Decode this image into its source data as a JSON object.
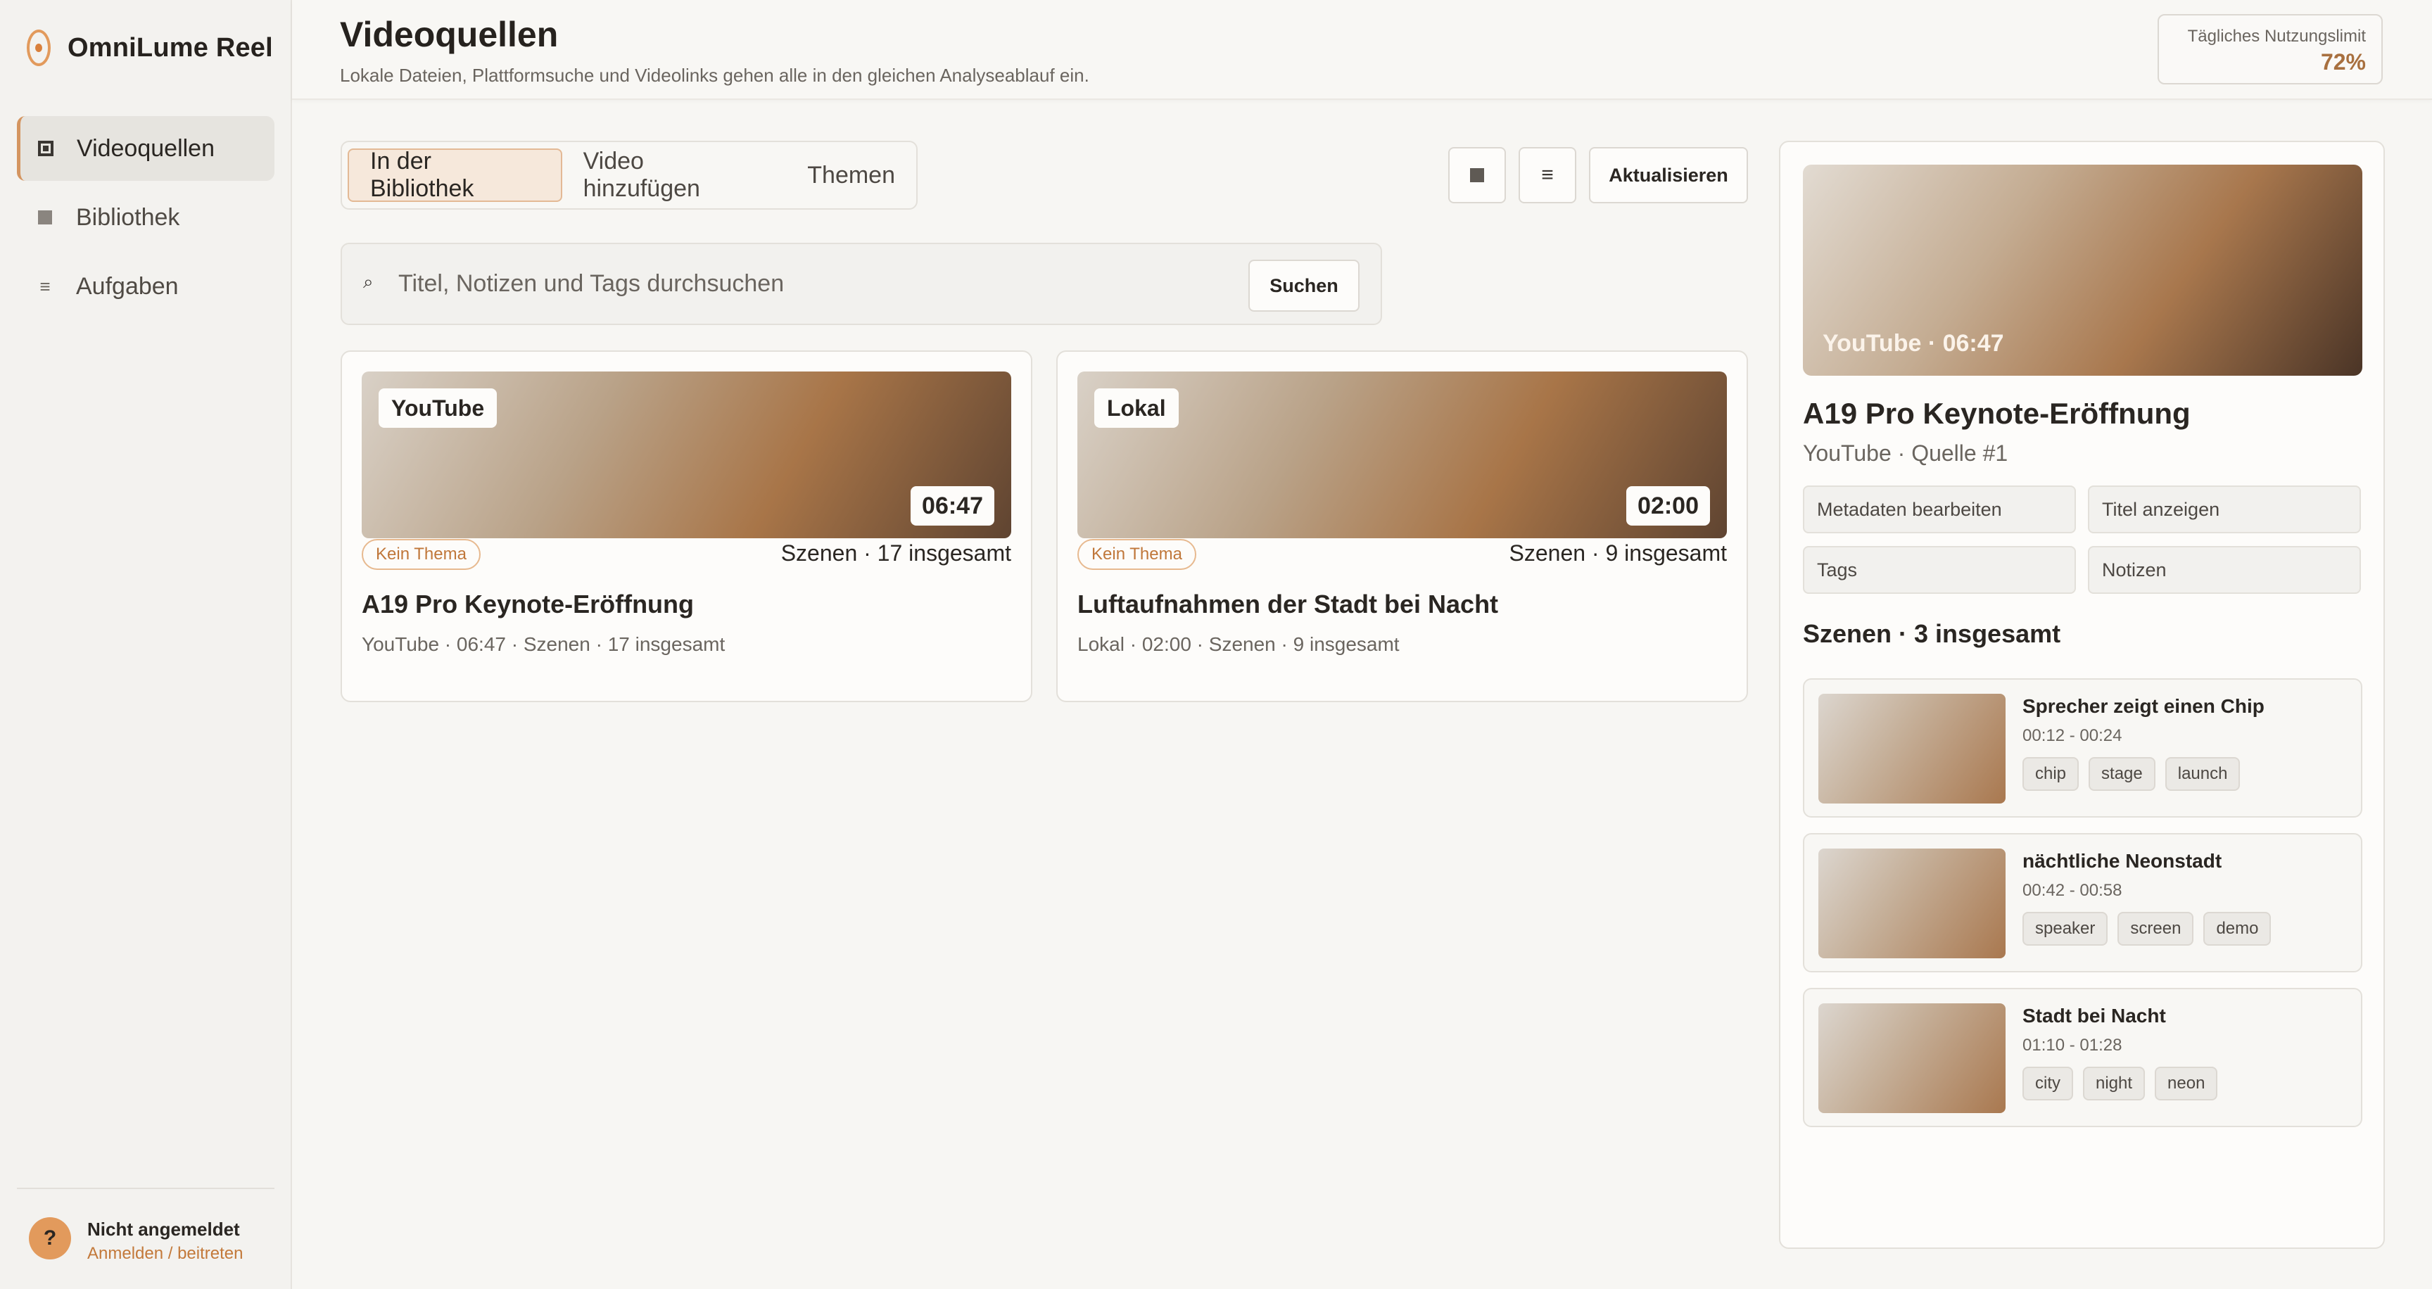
{
  "app": {
    "name": "OmniLume Reel"
  },
  "sidebar": {
    "items": [
      {
        "label": "Videoquellen",
        "icon": "video-sources-icon"
      },
      {
        "label": "Bibliothek",
        "icon": "library-icon"
      },
      {
        "label": "Aufgaben",
        "icon": "tasks-icon"
      }
    ],
    "user": {
      "avatar": "?",
      "name": "Nicht angemeldet",
      "link": "Anmelden / beitreten"
    }
  },
  "header": {
    "title": "Videoquellen",
    "subtitle": "Lokale Dateien, Plattformsuche und Videolinks gehen alle in den gleichen Analyseablauf ein.",
    "usage_label": "Tägliches Nutzungslimit",
    "usage_value": "72%",
    "usage_fraction": 0.72
  },
  "tabs": [
    {
      "label": "In der Bibliothek",
      "active": true
    },
    {
      "label": "Video hinzufügen",
      "active": false
    },
    {
      "label": "Themen",
      "active": false
    }
  ],
  "toolbar": {
    "grid_icon": "grid-view-icon",
    "list_icon": "list-view-icon",
    "list_glyph": "≡",
    "refresh_label": "Aktualisieren"
  },
  "search": {
    "icon_glyph": "⌕",
    "placeholder": "Titel, Notizen und Tags durchsuchen",
    "value": "",
    "button_label": "Suchen"
  },
  "cards": [
    {
      "source": "YouTube",
      "duration": "06:47",
      "theme": "Kein Thema",
      "scenes": "Szenen · 17 insgesamt",
      "title": "A19 Pro Keynote-Eröffnung",
      "meta": "YouTube · 06:47 · Szenen · 17 insgesamt"
    },
    {
      "source": "Lokal",
      "duration": "02:00",
      "theme": "Kein Thema",
      "scenes": "Szenen · 9 insgesamt",
      "title": "Luftaufnahmen der Stadt bei Nacht",
      "meta": "Lokal · 02:00 · Szenen · 9 insgesamt"
    }
  ],
  "detail": {
    "thumb_label": "YouTube · 06:47",
    "title": "A19 Pro Keynote-Eröffnung",
    "subtitle": "YouTube · Quelle #1",
    "buttons": [
      "Metadaten bearbeiten",
      "Titel anzeigen",
      "Tags",
      "Notizen"
    ],
    "scenes_heading": "Szenen · 3 insgesamt",
    "scenes": [
      {
        "title": "Sprecher zeigt einen Chip",
        "time": "00:12 - 00:24",
        "tags": [
          "chip",
          "stage",
          "launch"
        ]
      },
      {
        "title": "nächtliche Neonstadt",
        "time": "00:42 - 00:58",
        "tags": [
          "speaker",
          "screen",
          "demo"
        ]
      },
      {
        "title": "Stadt bei Nacht",
        "time": "01:10 - 01:28",
        "tags": [
          "city",
          "night",
          "neon"
        ]
      }
    ]
  },
  "colors": {
    "accent": "#d49560",
    "accent_text": "#c3793a",
    "background": "#f7f6f3",
    "card": "#fdfcfa"
  }
}
